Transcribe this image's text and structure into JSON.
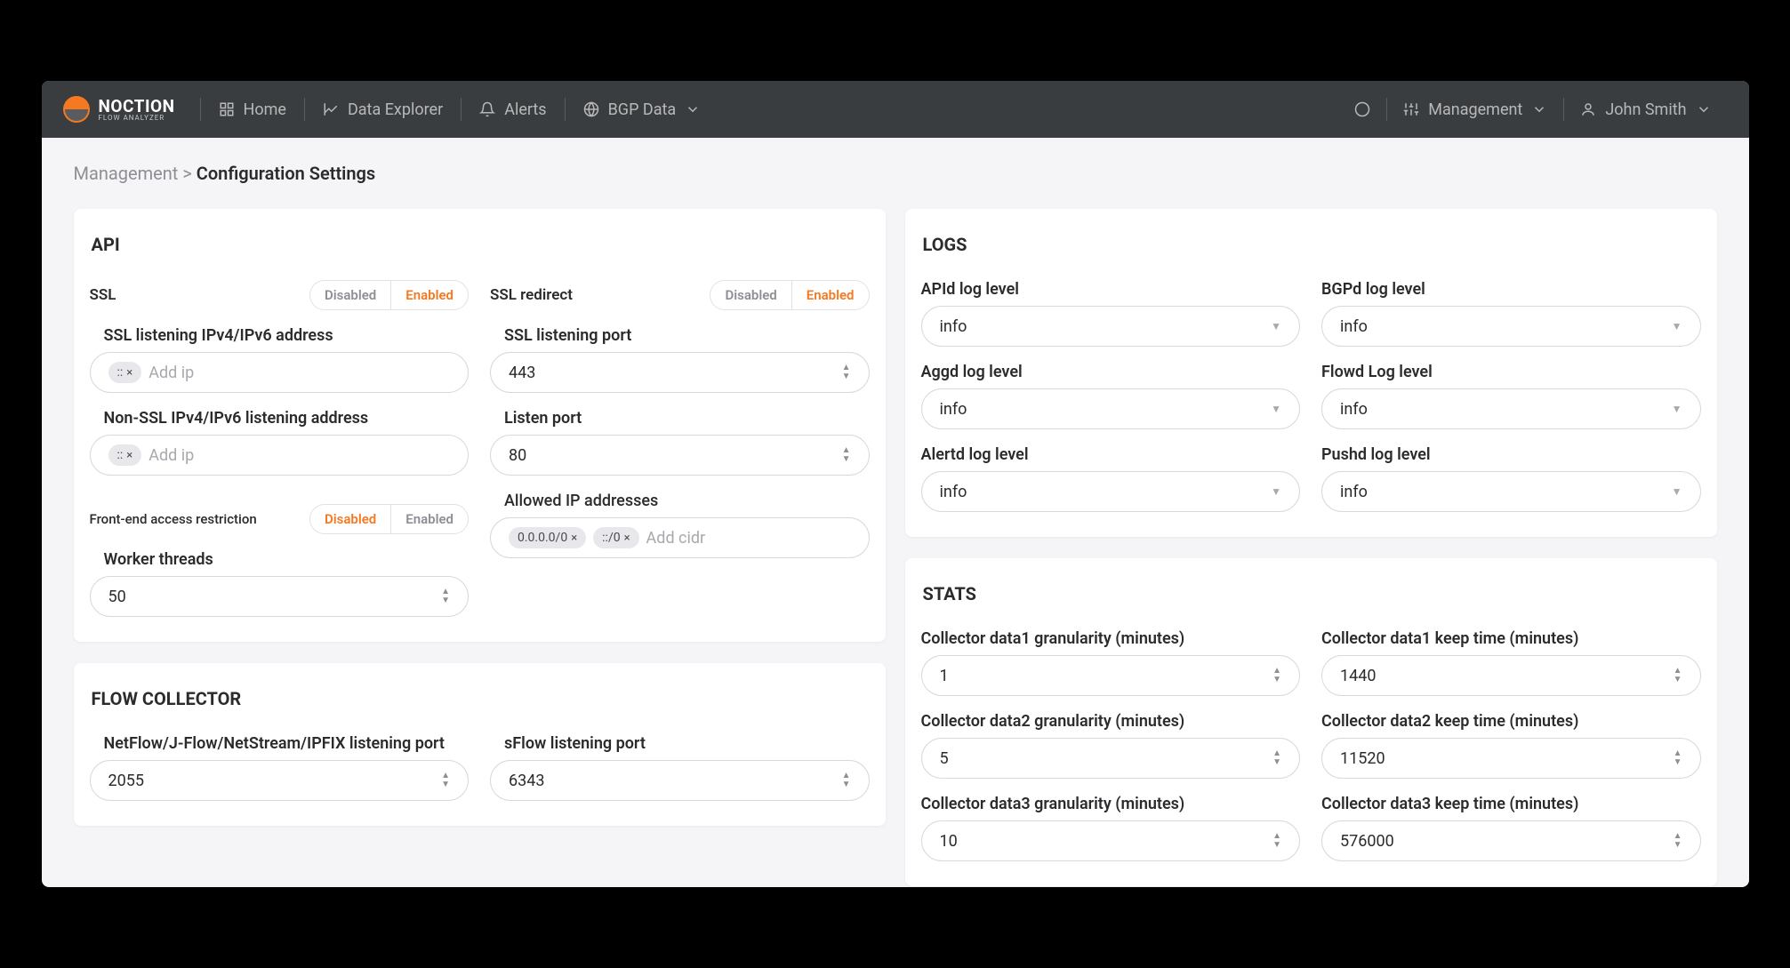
{
  "brand": {
    "name": "NOCTION",
    "tagline": "FLOW ANALYZER"
  },
  "nav": {
    "home": "Home",
    "dataExplorer": "Data Explorer",
    "alerts": "Alerts",
    "bgpData": "BGP Data",
    "management": "Management",
    "user": "John Smith"
  },
  "breadcrumb": {
    "parent": "Management",
    "sep": ">",
    "current": "Configuration Settings"
  },
  "api": {
    "title": "API",
    "ssl": {
      "label": "SSL",
      "disabled": "Disabled",
      "enabled": "Enabled",
      "active": "enabled"
    },
    "sslRedirect": {
      "label": "SSL redirect",
      "disabled": "Disabled",
      "enabled": "Enabled",
      "active": "enabled"
    },
    "sslListeningAddr": {
      "label": "SSL listening IPv4/IPv6 address",
      "tags": [
        "::"
      ],
      "placeholder": "Add ip"
    },
    "nonSslAddr": {
      "label": "Non-SSL IPv4/IPv6 listening address",
      "tags": [
        "::"
      ],
      "placeholder": "Add ip"
    },
    "sslPort": {
      "label": "SSL listening port",
      "value": "443"
    },
    "listenPort": {
      "label": "Listen port",
      "value": "80"
    },
    "allowedIps": {
      "label": "Allowed IP addresses",
      "tags": [
        "0.0.0.0/0",
        "::/0"
      ],
      "placeholder": "Add cidr"
    },
    "frontend": {
      "label": "Front-end access restriction",
      "disabled": "Disabled",
      "enabled": "Enabled",
      "active": "disabled"
    },
    "workerThreads": {
      "label": "Worker threads",
      "value": "50"
    }
  },
  "flowCollector": {
    "title": "FLOW COLLECTOR",
    "netflowPort": {
      "label": "NetFlow/J-Flow/NetStream/IPFIX listening port",
      "value": "2055"
    },
    "sflowPort": {
      "label": "sFlow listening port",
      "value": "6343"
    }
  },
  "logs": {
    "title": "LOGS",
    "fields": [
      {
        "label": "APId log level",
        "value": "info"
      },
      {
        "label": "BGPd log level",
        "value": "info"
      },
      {
        "label": "Aggd log level",
        "value": "info"
      },
      {
        "label": "Flowd Log level",
        "value": "info"
      },
      {
        "label": "Alertd log level",
        "value": "info"
      },
      {
        "label": "Pushd log level",
        "value": "info"
      }
    ]
  },
  "stats": {
    "title": "STATS",
    "fields": [
      {
        "label": "Collector data1 granularity (minutes)",
        "value": "1"
      },
      {
        "label": "Collector data1 keep time (minutes)",
        "value": "1440"
      },
      {
        "label": "Collector data2 granularity (minutes)",
        "value": "5"
      },
      {
        "label": "Collector data2 keep time (minutes)",
        "value": "11520"
      },
      {
        "label": "Collector data3 granularity (minutes)",
        "value": "10"
      },
      {
        "label": "Collector data3 keep time (minutes)",
        "value": "576000"
      }
    ]
  }
}
